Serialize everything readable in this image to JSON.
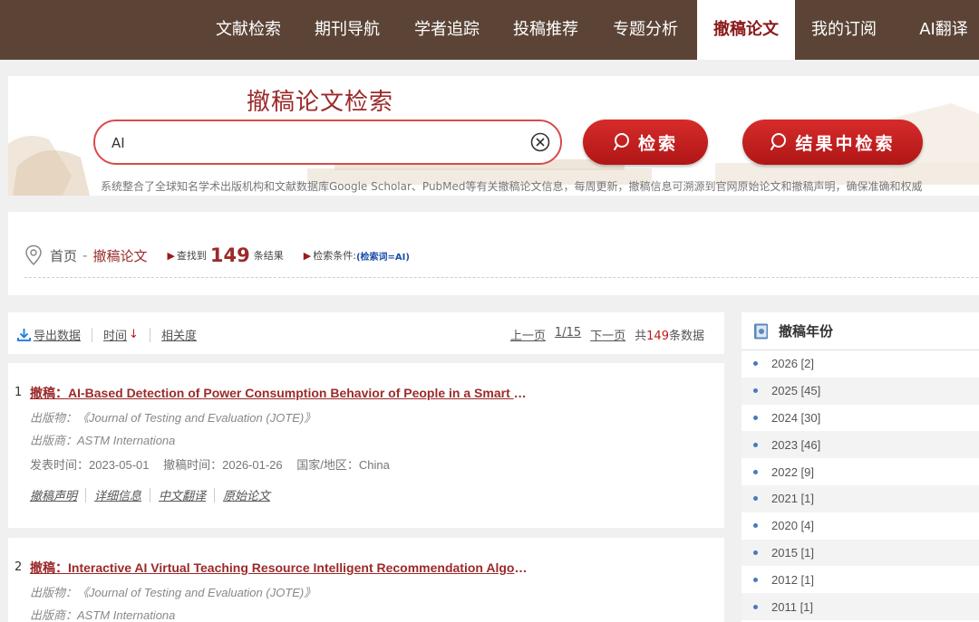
{
  "nav": {
    "items": [
      {
        "label": "文献检索",
        "active": false
      },
      {
        "label": "期刊导航",
        "active": false
      },
      {
        "label": "学者追踪",
        "active": false
      },
      {
        "label": "投稿推荐",
        "active": false
      },
      {
        "label": "专题分析",
        "active": false
      },
      {
        "label": "撤稿论文",
        "active": true
      },
      {
        "label": "我的订阅",
        "active": false
      },
      {
        "label": "AI翻译",
        "active": false
      }
    ]
  },
  "search": {
    "title": "撤稿论文检索",
    "value": "AI",
    "search_button": "检索",
    "refine_button": "结果中检索",
    "note": "系统整合了全球知名学术出版机构和文献数据库Google Scholar、PubMed等有关撤稿论文信息，每周更新，撤稿信息可溯源到官网原始论文和撤稿声明，确保准确和权威"
  },
  "breadcrumb": {
    "home": "首页",
    "sep": "-",
    "current": "撤稿论文",
    "found_label": "查找到",
    "found_count": "149",
    "found_suffix": "条结果",
    "condition_label": "检索条件:",
    "condition_value": "(检索词=AI)"
  },
  "toolbar": {
    "export": "导出数据",
    "sort_time": "时间",
    "sort_time_arrow": "↓",
    "sort_relevance": "相关度",
    "prev_page": "上一页",
    "page_indicator": "1/15",
    "next_page": "下一页",
    "total_prefix": "共",
    "total_count": "149",
    "total_suffix": "条数据"
  },
  "results": [
    {
      "num": "1",
      "title": "撤稿：AI-Based Detection of Power Consumption Behavior of People in a Smart City",
      "journal": "出版物：《Journal of Testing and Evaluation (JOTE)》",
      "publisher": "出版商：ASTM Internationa",
      "published": "发表时间：2023-05-01",
      "retracted": "撤稿时间：2026-01-26",
      "country": "国家/地区：China",
      "actions": [
        "撤稿声明",
        "详细信息",
        "中文翻译",
        "原始论文"
      ]
    },
    {
      "num": "2",
      "title": "撤稿：Interactive AI Virtual Teaching Resource Intelligent Recommendation Algori...",
      "journal": "出版物：《Journal of Testing and Evaluation (JOTE)》",
      "publisher": "出版商：ASTM Internationa"
    }
  ],
  "sidebar": {
    "title": "撤稿年份",
    "years": [
      "2026 [2]",
      "2025 [45]",
      "2024 [30]",
      "2023 [46]",
      "2022 [9]",
      "2021 [1]",
      "2020 [4]",
      "2015 [1]",
      "2012 [1]",
      "2011 [1]"
    ]
  },
  "colors": {
    "nav_bg": "#5b4436",
    "accent_red": "#9c2a2a",
    "button_red": "#c41f1f",
    "link_blue": "#1d4fa8"
  }
}
